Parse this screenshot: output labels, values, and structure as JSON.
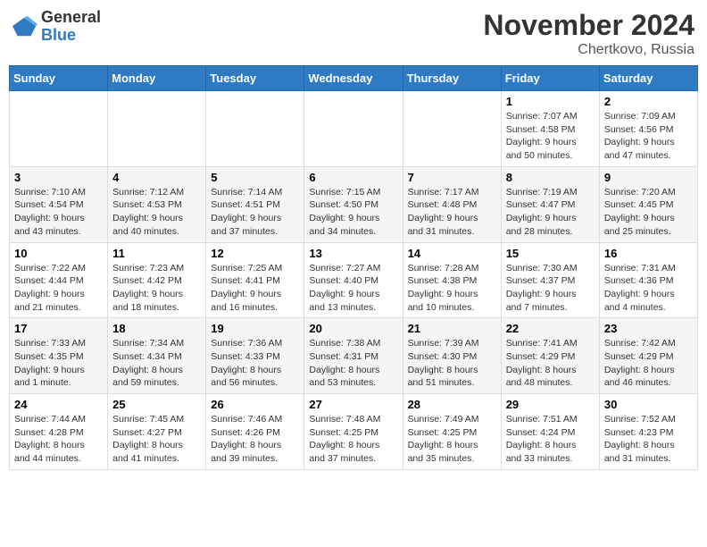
{
  "header": {
    "logo_general": "General",
    "logo_blue": "Blue",
    "month_title": "November 2024",
    "location": "Chertkovo, Russia"
  },
  "days_of_week": [
    "Sunday",
    "Monday",
    "Tuesday",
    "Wednesday",
    "Thursday",
    "Friday",
    "Saturday"
  ],
  "weeks": [
    [
      {
        "day": "",
        "info": ""
      },
      {
        "day": "",
        "info": ""
      },
      {
        "day": "",
        "info": ""
      },
      {
        "day": "",
        "info": ""
      },
      {
        "day": "",
        "info": ""
      },
      {
        "day": "1",
        "info": "Sunrise: 7:07 AM\nSunset: 4:58 PM\nDaylight: 9 hours and 50 minutes."
      },
      {
        "day": "2",
        "info": "Sunrise: 7:09 AM\nSunset: 4:56 PM\nDaylight: 9 hours and 47 minutes."
      }
    ],
    [
      {
        "day": "3",
        "info": "Sunrise: 7:10 AM\nSunset: 4:54 PM\nDaylight: 9 hours and 43 minutes."
      },
      {
        "day": "4",
        "info": "Sunrise: 7:12 AM\nSunset: 4:53 PM\nDaylight: 9 hours and 40 minutes."
      },
      {
        "day": "5",
        "info": "Sunrise: 7:14 AM\nSunset: 4:51 PM\nDaylight: 9 hours and 37 minutes."
      },
      {
        "day": "6",
        "info": "Sunrise: 7:15 AM\nSunset: 4:50 PM\nDaylight: 9 hours and 34 minutes."
      },
      {
        "day": "7",
        "info": "Sunrise: 7:17 AM\nSunset: 4:48 PM\nDaylight: 9 hours and 31 minutes."
      },
      {
        "day": "8",
        "info": "Sunrise: 7:19 AM\nSunset: 4:47 PM\nDaylight: 9 hours and 28 minutes."
      },
      {
        "day": "9",
        "info": "Sunrise: 7:20 AM\nSunset: 4:45 PM\nDaylight: 9 hours and 25 minutes."
      }
    ],
    [
      {
        "day": "10",
        "info": "Sunrise: 7:22 AM\nSunset: 4:44 PM\nDaylight: 9 hours and 21 minutes."
      },
      {
        "day": "11",
        "info": "Sunrise: 7:23 AM\nSunset: 4:42 PM\nDaylight: 9 hours and 18 minutes."
      },
      {
        "day": "12",
        "info": "Sunrise: 7:25 AM\nSunset: 4:41 PM\nDaylight: 9 hours and 16 minutes."
      },
      {
        "day": "13",
        "info": "Sunrise: 7:27 AM\nSunset: 4:40 PM\nDaylight: 9 hours and 13 minutes."
      },
      {
        "day": "14",
        "info": "Sunrise: 7:28 AM\nSunset: 4:38 PM\nDaylight: 9 hours and 10 minutes."
      },
      {
        "day": "15",
        "info": "Sunrise: 7:30 AM\nSunset: 4:37 PM\nDaylight: 9 hours and 7 minutes."
      },
      {
        "day": "16",
        "info": "Sunrise: 7:31 AM\nSunset: 4:36 PM\nDaylight: 9 hours and 4 minutes."
      }
    ],
    [
      {
        "day": "17",
        "info": "Sunrise: 7:33 AM\nSunset: 4:35 PM\nDaylight: 9 hours and 1 minute."
      },
      {
        "day": "18",
        "info": "Sunrise: 7:34 AM\nSunset: 4:34 PM\nDaylight: 8 hours and 59 minutes."
      },
      {
        "day": "19",
        "info": "Sunrise: 7:36 AM\nSunset: 4:33 PM\nDaylight: 8 hours and 56 minutes."
      },
      {
        "day": "20",
        "info": "Sunrise: 7:38 AM\nSunset: 4:31 PM\nDaylight: 8 hours and 53 minutes."
      },
      {
        "day": "21",
        "info": "Sunrise: 7:39 AM\nSunset: 4:30 PM\nDaylight: 8 hours and 51 minutes."
      },
      {
        "day": "22",
        "info": "Sunrise: 7:41 AM\nSunset: 4:29 PM\nDaylight: 8 hours and 48 minutes."
      },
      {
        "day": "23",
        "info": "Sunrise: 7:42 AM\nSunset: 4:29 PM\nDaylight: 8 hours and 46 minutes."
      }
    ],
    [
      {
        "day": "24",
        "info": "Sunrise: 7:44 AM\nSunset: 4:28 PM\nDaylight: 8 hours and 44 minutes."
      },
      {
        "day": "25",
        "info": "Sunrise: 7:45 AM\nSunset: 4:27 PM\nDaylight: 8 hours and 41 minutes."
      },
      {
        "day": "26",
        "info": "Sunrise: 7:46 AM\nSunset: 4:26 PM\nDaylight: 8 hours and 39 minutes."
      },
      {
        "day": "27",
        "info": "Sunrise: 7:48 AM\nSunset: 4:25 PM\nDaylight: 8 hours and 37 minutes."
      },
      {
        "day": "28",
        "info": "Sunrise: 7:49 AM\nSunset: 4:25 PM\nDaylight: 8 hours and 35 minutes."
      },
      {
        "day": "29",
        "info": "Sunrise: 7:51 AM\nSunset: 4:24 PM\nDaylight: 8 hours and 33 minutes."
      },
      {
        "day": "30",
        "info": "Sunrise: 7:52 AM\nSunset: 4:23 PM\nDaylight: 8 hours and 31 minutes."
      }
    ]
  ]
}
